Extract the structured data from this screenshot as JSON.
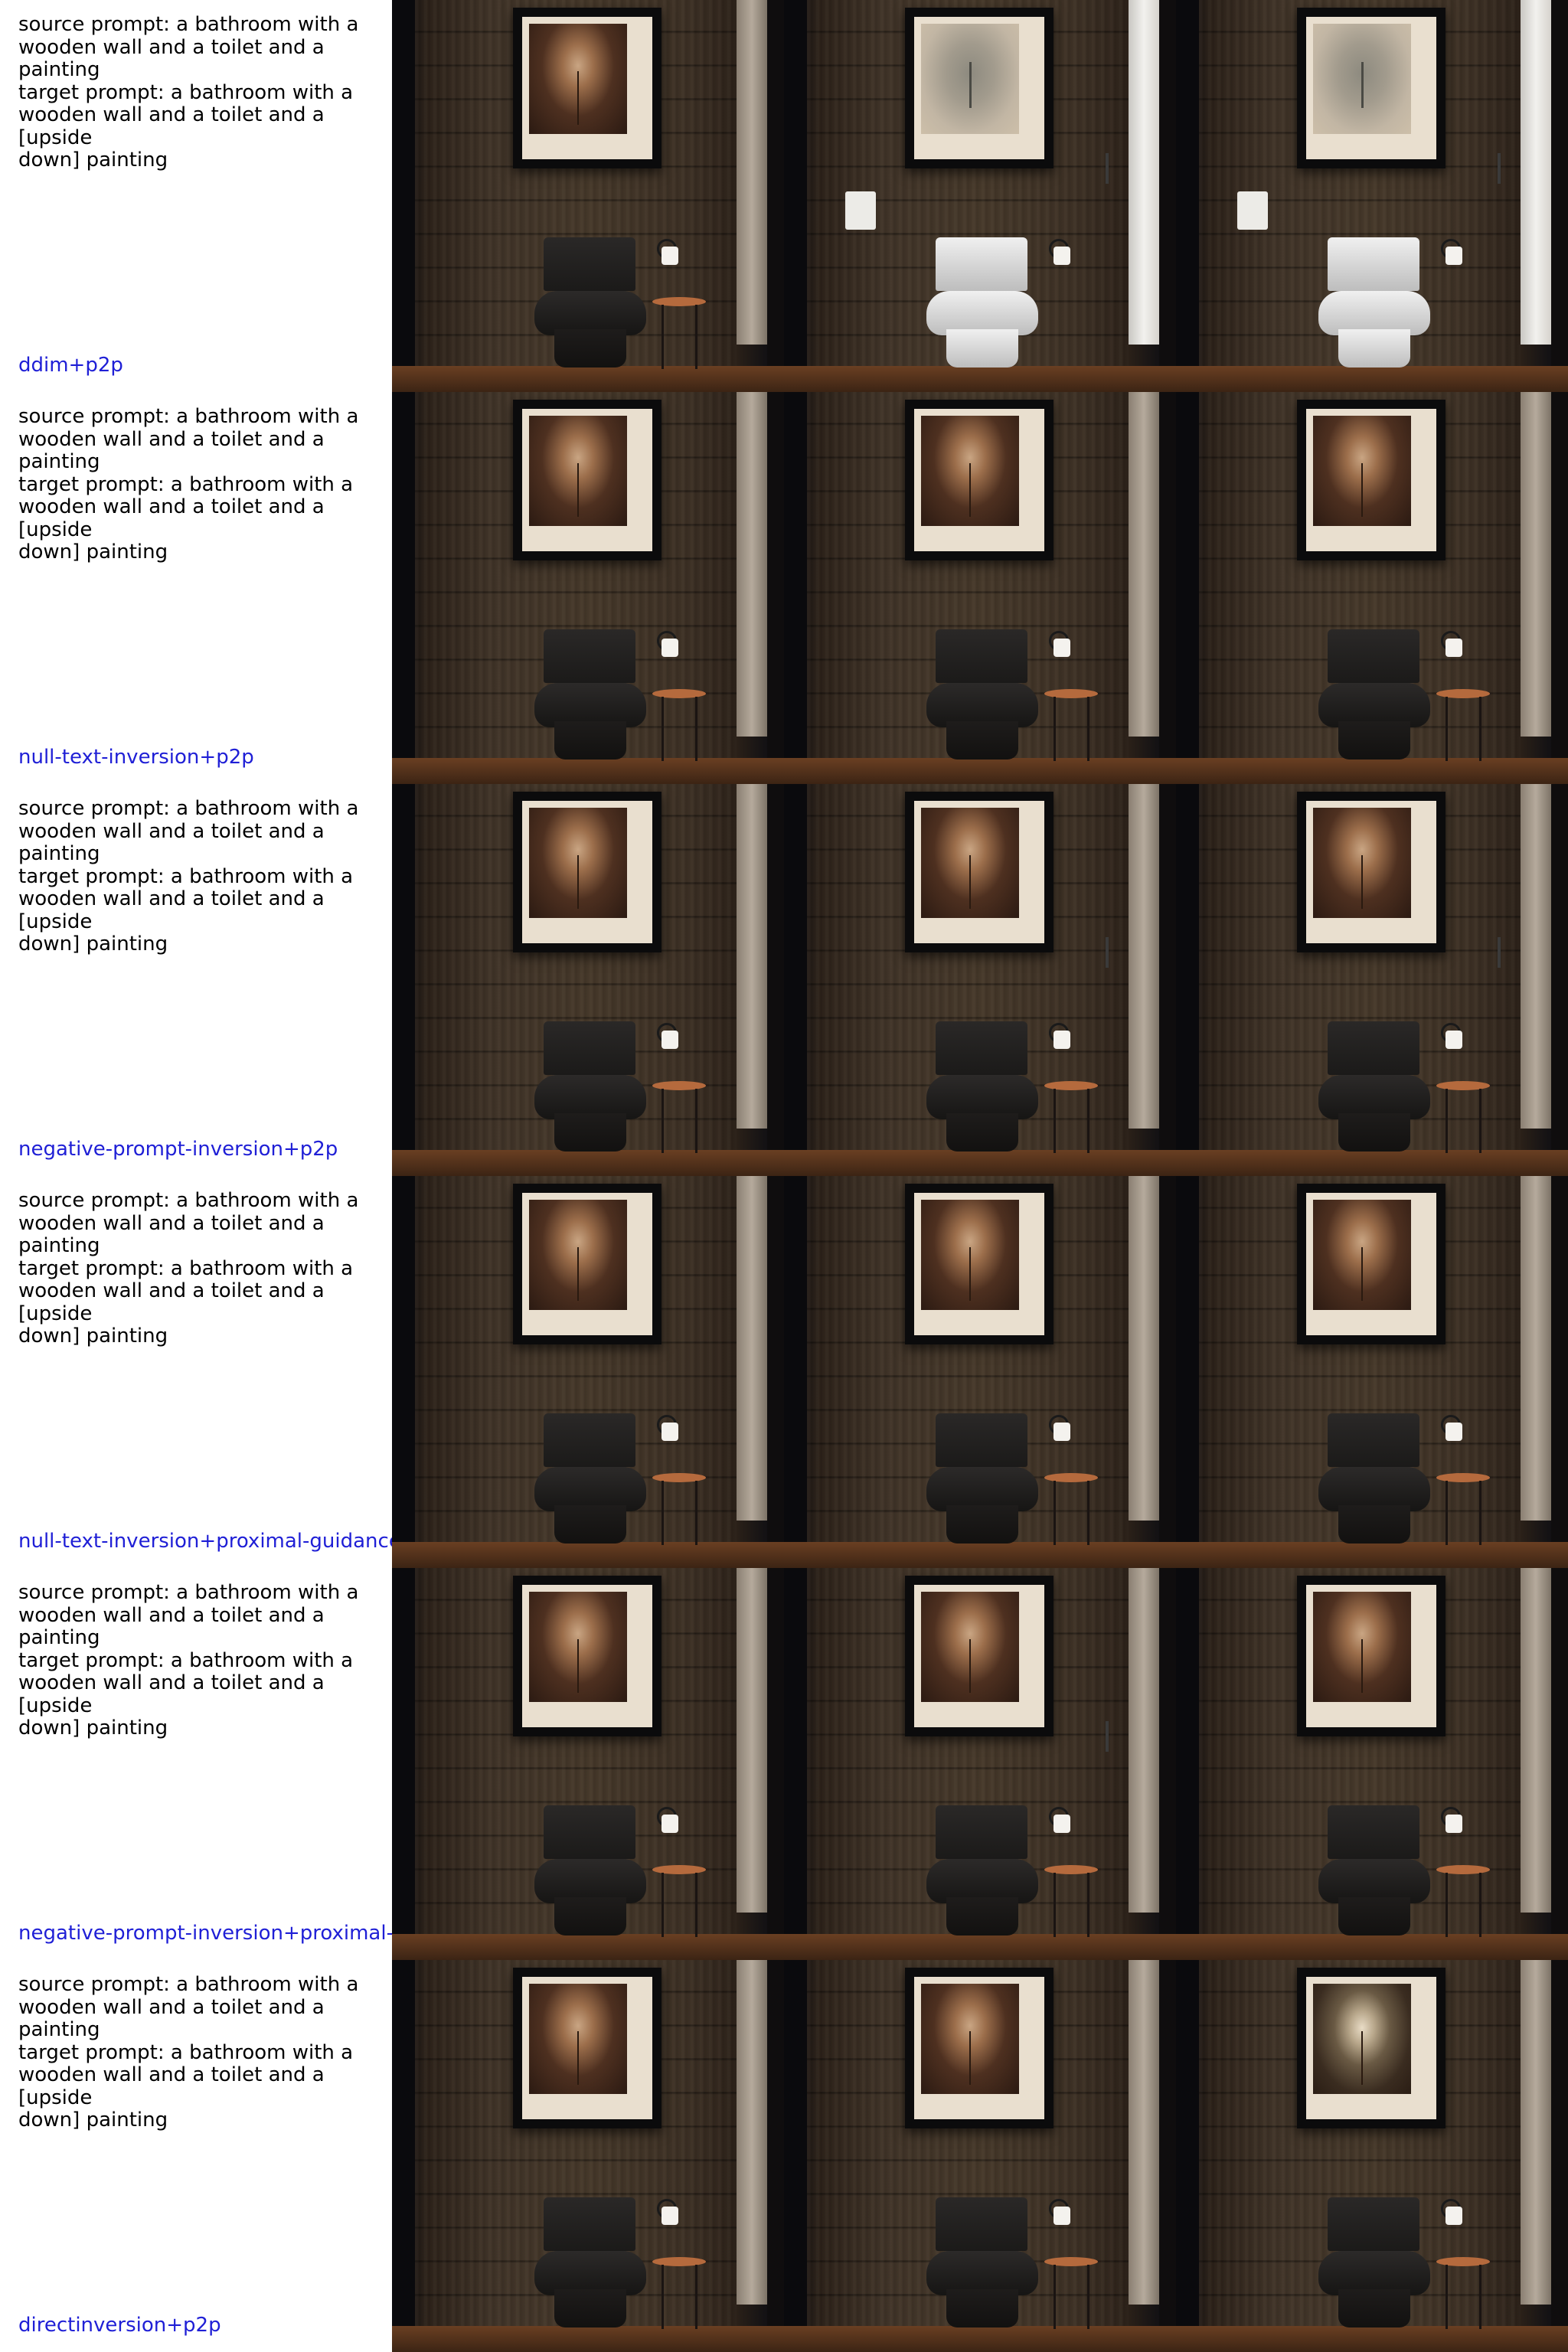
{
  "rows": [
    {
      "prompt": "source prompt: a bathroom with a\nwooden wall and a toilet and a\npainting\ntarget prompt: a bathroom with a\nwooden wall and a toilet and a [upside\ndown] painting",
      "method": "ddim+p2p"
    },
    {
      "prompt": "source prompt: a bathroom with a\nwooden wall and a toilet and a\npainting\ntarget prompt: a bathroom with a\nwooden wall and a toilet and a [upside\ndown] painting",
      "method": "null-text-inversion+p2p"
    },
    {
      "prompt": "source prompt: a bathroom with a\nwooden wall and a toilet and a\npainting\ntarget prompt: a bathroom with a\nwooden wall and a toilet and a [upside\ndown] painting",
      "method": "negative-prompt-inversion+p2p"
    },
    {
      "prompt": "source prompt: a bathroom with a\nwooden wall and a toilet and a\npainting\ntarget prompt: a bathroom with a\nwooden wall and a toilet and a [upside\ndown] painting",
      "method": "null-text-inversion+proximal-guidance"
    },
    {
      "prompt": "source prompt: a bathroom with a\nwooden wall and a toilet and a\npainting\ntarget prompt: a bathroom with a\nwooden wall and a toilet and a [upside\ndown] painting",
      "method": "negative-prompt-inversion+proximal-g"
    },
    {
      "prompt": "source prompt: a bathroom with a\nwooden wall and a toilet and a\npainting\ntarget prompt: a bathroom with a\nwooden wall and a toilet and a [upside\ndown] painting",
      "method": "directinversion+p2p"
    }
  ],
  "colors": {
    "prompt_text": "#000000",
    "method_text": "#1f1fd6",
    "background": "#ffffff"
  }
}
